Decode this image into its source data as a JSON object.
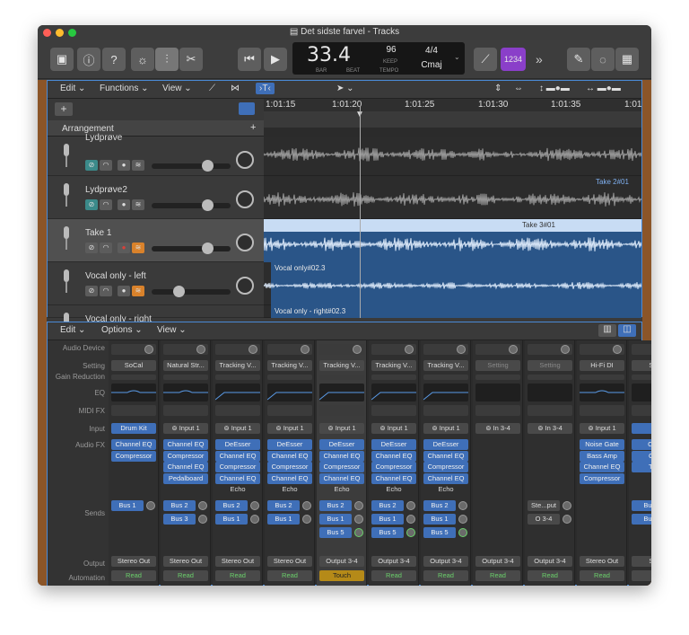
{
  "window": {
    "title": "Det sidste farvel - Tracks"
  },
  "lcd": {
    "position": "33.4",
    "bar_label": "BAR",
    "beat_label": "BEAT",
    "tempo": "96",
    "keep_label": "KEEP",
    "tempo_label": "TEMPO",
    "time_sig": "4/4",
    "key": "Cmaj"
  },
  "toolbar": {
    "count_in": "1234",
    "more": "»"
  },
  "tracks": {
    "menu": {
      "edit": "Edit",
      "functions": "Functions",
      "view": "View"
    },
    "arrangement": "Arrangement",
    "ruler": [
      "1:01:15",
      "1:01:20",
      "1:01:25",
      "1:01:30",
      "1:01:35",
      "1:01"
    ],
    "rows": [
      {
        "name": "Lydprøve"
      },
      {
        "name": "Lydprøve2",
        "region": "Take 2#01"
      },
      {
        "name": "Take 1",
        "region": "Take 3#01"
      },
      {
        "name": "Vocal only - left",
        "region": "Vocal only#02.3"
      },
      {
        "name": "Vocal only - right",
        "region": "Vocal only - right#02.3"
      }
    ]
  },
  "mixer": {
    "menu": {
      "edit": "Edit",
      "options": "Options",
      "view": "View"
    },
    "row_labels": {
      "audio_device": "Audio Device",
      "setting": "Setting",
      "gain_reduction": "Gain Reduction",
      "eq": "EQ",
      "midi_fx": "MIDI FX",
      "input": "Input",
      "audio_fx": "Audio FX",
      "sends": "Sends",
      "output": "Output",
      "automation": "Automation"
    },
    "strips": [
      {
        "setting": "SoCal",
        "input": "Drum Kit",
        "fx": [
          "Channel EQ",
          "Compressor"
        ],
        "sends": [
          "Bus 1"
        ],
        "output": "Stereo Out",
        "automation": "Read"
      },
      {
        "setting": "Natural Str...",
        "input": "Input 1",
        "fx": [
          "Channel EQ",
          "Compressor",
          "Channel EQ",
          "Pedalboard"
        ],
        "sends": [
          "Bus 2",
          "Bus 3"
        ],
        "output": "Stereo Out",
        "automation": "Read"
      },
      {
        "setting": "Tracking V...",
        "input": "Input 1",
        "fx": [
          "DeEsser",
          "Channel EQ",
          "Compressor",
          "Channel EQ",
          "Echo"
        ],
        "sends": [
          "Bus 2",
          "Bus 1"
        ],
        "output": "Stereo Out",
        "automation": "Read"
      },
      {
        "setting": "Tracking V...",
        "input": "Input 1",
        "fx": [
          "DeEsser",
          "Channel EQ",
          "Compressor",
          "Channel EQ",
          "Echo"
        ],
        "sends": [
          "Bus 2",
          "Bus 1"
        ],
        "output": "Stereo Out",
        "automation": "Read"
      },
      {
        "setting": "Tracking V...",
        "input": "Input 1",
        "fx": [
          "DeEsser",
          "Channel EQ",
          "Compressor",
          "Channel EQ",
          "Echo"
        ],
        "sends": [
          "Bus 2",
          "Bus 1",
          "Bus 5"
        ],
        "output": "Output 3-4",
        "automation": "Touch"
      },
      {
        "setting": "Tracking V...",
        "input": "Input 1",
        "fx": [
          "DeEsser",
          "Channel EQ",
          "Compressor",
          "Channel EQ",
          "Echo"
        ],
        "sends": [
          "Bus 2",
          "Bus 1",
          "Bus 5"
        ],
        "output": "Output 3-4",
        "automation": "Read"
      },
      {
        "setting": "Tracking V...",
        "input": "Input 1",
        "fx": [
          "DeEsser",
          "Channel EQ",
          "Compressor",
          "Channel EQ",
          "Echo"
        ],
        "sends": [
          "Bus 2",
          "Bus 1",
          "Bus 5"
        ],
        "output": "Output 3-4",
        "automation": "Read"
      },
      {
        "setting": "Setting",
        "input": "In 3-4",
        "fx": [],
        "sends": [],
        "output": "Output 3-4",
        "automation": "Read"
      },
      {
        "setting": "Setting",
        "input": "In 3-4",
        "fx": [],
        "sends": [
          "Ste...put",
          "O 3-4"
        ],
        "output": "Output 3-4",
        "automation": "Read"
      },
      {
        "setting": "Hi-Fi DI",
        "input": "Input 1",
        "fx": [
          "Noise Gate",
          "Bass Amp",
          "Channel EQ",
          "Compressor"
        ],
        "sends": [],
        "output": "Stereo Out",
        "automation": "Read"
      },
      {
        "setting": "Ste",
        "input": "",
        "fx": [
          "Cha",
          "Cor",
          "Tap"
        ],
        "sends": [
          "Bu",
          "Bu"
        ],
        "output": "Ste",
        "automation": ""
      }
    ]
  },
  "colors": {
    "accent": "#3f6fb8",
    "wood": "#8b5528",
    "record": "#d9413a",
    "count_in": "#8a3fc9",
    "touch": "#b58a18",
    "read": "#6bd06b"
  }
}
